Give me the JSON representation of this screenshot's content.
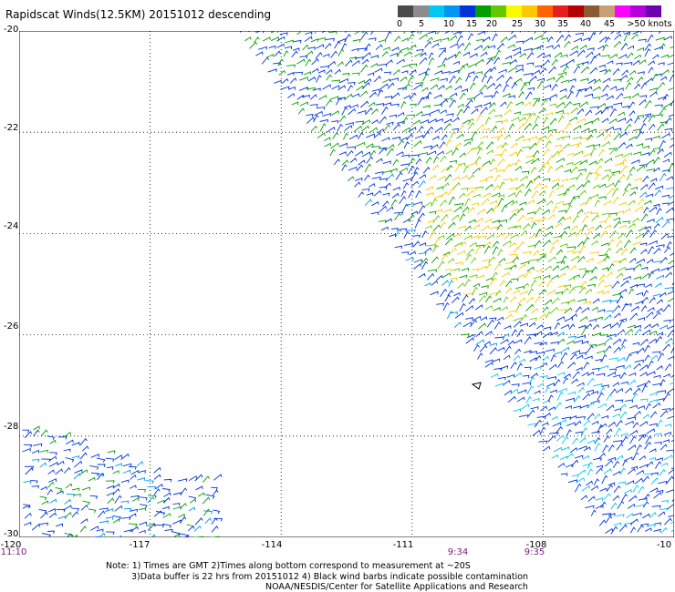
{
  "title": "Rapidscat Winds(12.5KM) 20151012 descending",
  "legend": {
    "colors": [
      "#4a4a4a",
      "#8c8c8c",
      "#00c8f0",
      "#0096f0",
      "#0032dc",
      "#00a000",
      "#64c800",
      "#fafa00",
      "#ffc800",
      "#ff6400",
      "#e61e1e",
      "#b40000",
      "#8c5a32",
      "#c8a078",
      "#ff00ff",
      "#b400dc",
      "#6e00b4"
    ],
    "labels": [
      "0",
      "5",
      "10",
      "15",
      "20",
      "25",
      "30",
      "35",
      "40",
      "45",
      ">50 knots"
    ]
  },
  "axes": {
    "y_labels": [
      "-20",
      "-22",
      "-24",
      "-26",
      "-28",
      "-30"
    ],
    "x_labels": [
      "-120",
      "-117",
      "-114",
      "-111",
      "-108",
      "-10"
    ],
    "x_range": [
      -120,
      -105
    ],
    "y_range": [
      -30,
      -20
    ],
    "grid": "dotted"
  },
  "times": [
    "11:10",
    "9:34",
    "9:35"
  ],
  "notes": {
    "line1": "Note: 1) Times are GMT 2)Times along bottom correspond to measurement at ~20S",
    "line2": "3)Data buffer is 22 hrs from 20151012 4) Black wind barbs indicate possible contamination",
    "line3": "NOAA/NESDIS/Center for Satellite Applications and Research"
  }
}
